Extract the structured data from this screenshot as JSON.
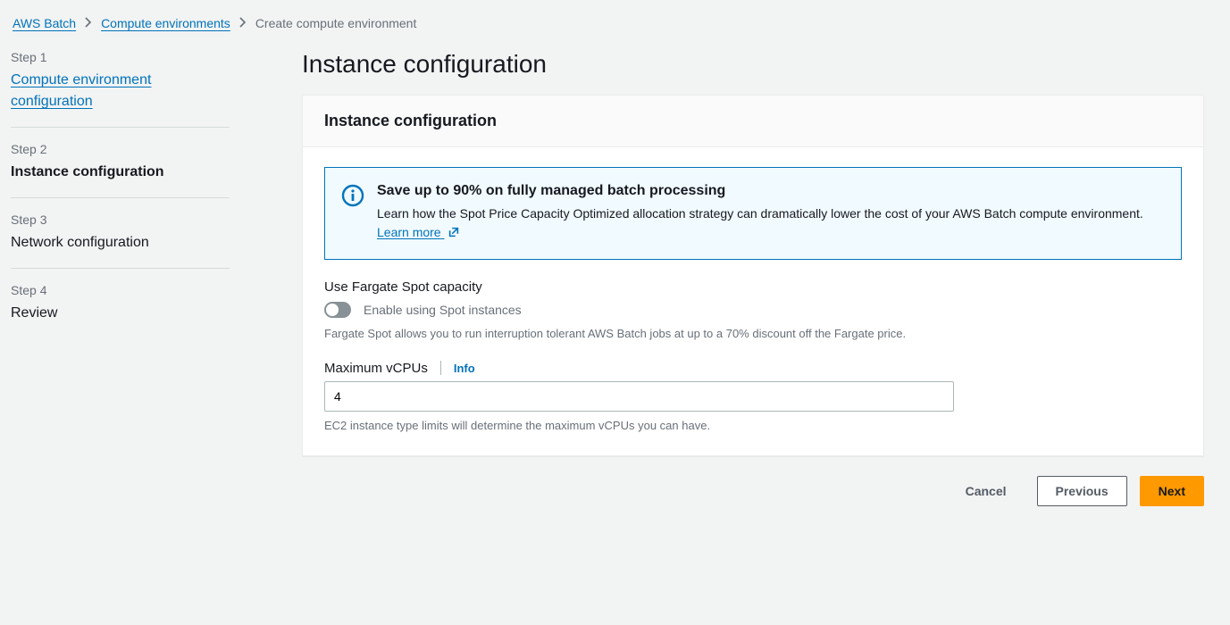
{
  "breadcrumb": {
    "items": [
      {
        "label": "AWS Batch",
        "link": true
      },
      {
        "label": "Compute environments",
        "link": true
      },
      {
        "label": "Create compute environment",
        "link": false
      }
    ]
  },
  "sidebar": {
    "steps": [
      {
        "num": "Step 1",
        "title": "Compute environment configuration",
        "state": "link"
      },
      {
        "num": "Step 2",
        "title": "Instance configuration",
        "state": "active"
      },
      {
        "num": "Step 3",
        "title": "Network configuration",
        "state": "normal"
      },
      {
        "num": "Step 4",
        "title": "Review",
        "state": "normal"
      }
    ]
  },
  "main": {
    "title": "Instance configuration",
    "panel_title": "Instance configuration",
    "alert": {
      "title": "Save up to 90% on fully managed batch processing",
      "body": "Learn how the Spot Price Capacity Optimized allocation strategy can dramatically lower the cost of your AWS Batch compute environment. ",
      "link_text": "Learn more"
    },
    "fargate": {
      "label": "Use Fargate Spot capacity",
      "toggle_label": "Enable using Spot instances",
      "hint": "Fargate Spot allows you to run interruption tolerant AWS Batch jobs at up to a 70% discount off the Fargate price."
    },
    "vcpu": {
      "label": "Maximum vCPUs",
      "info": "Info",
      "value": "4",
      "hint": "EC2 instance type limits will determine the maximum vCPUs you can have."
    }
  },
  "footer": {
    "cancel": "Cancel",
    "previous": "Previous",
    "next": "Next"
  }
}
